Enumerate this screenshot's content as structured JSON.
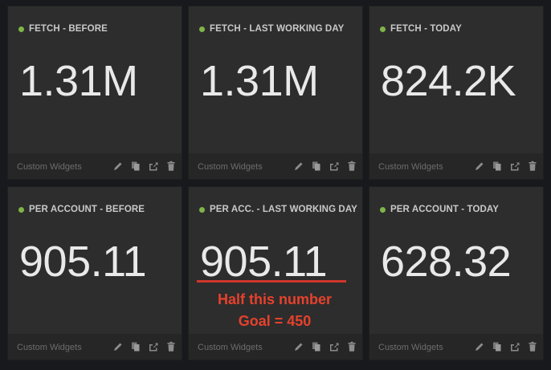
{
  "colors": {
    "background": "#17191c",
    "widget": "#2d2d2d",
    "footer": "#262626",
    "status_dot": "#7fb548",
    "annotation": "#e6412d"
  },
  "widgets": [
    {
      "title": "FETCH - BEFORE",
      "value": "1.31M",
      "footer": "Custom Widgets"
    },
    {
      "title": "FETCH - LAST WORKING DAY",
      "value": "1.31M",
      "footer": "Custom Widgets"
    },
    {
      "title": "FETCH - TODAY",
      "value": "824.2K",
      "footer": "Custom Widgets"
    },
    {
      "title": "PER ACCOUNT - BEFORE",
      "value": "905.11",
      "footer": "Custom Widgets"
    },
    {
      "title": "PER ACC. - LAST WORKING DAY",
      "value": "905.11",
      "footer": "Custom Widgets"
    },
    {
      "title": "PER ACCOUNT - TODAY",
      "value": "628.32",
      "footer": "Custom Widgets"
    }
  ],
  "annotation": {
    "line1": "Half this number",
    "line2": "Goal = 450"
  },
  "icons": [
    "edit-pencil-icon",
    "copy-icon",
    "share-icon",
    "trash-icon"
  ]
}
